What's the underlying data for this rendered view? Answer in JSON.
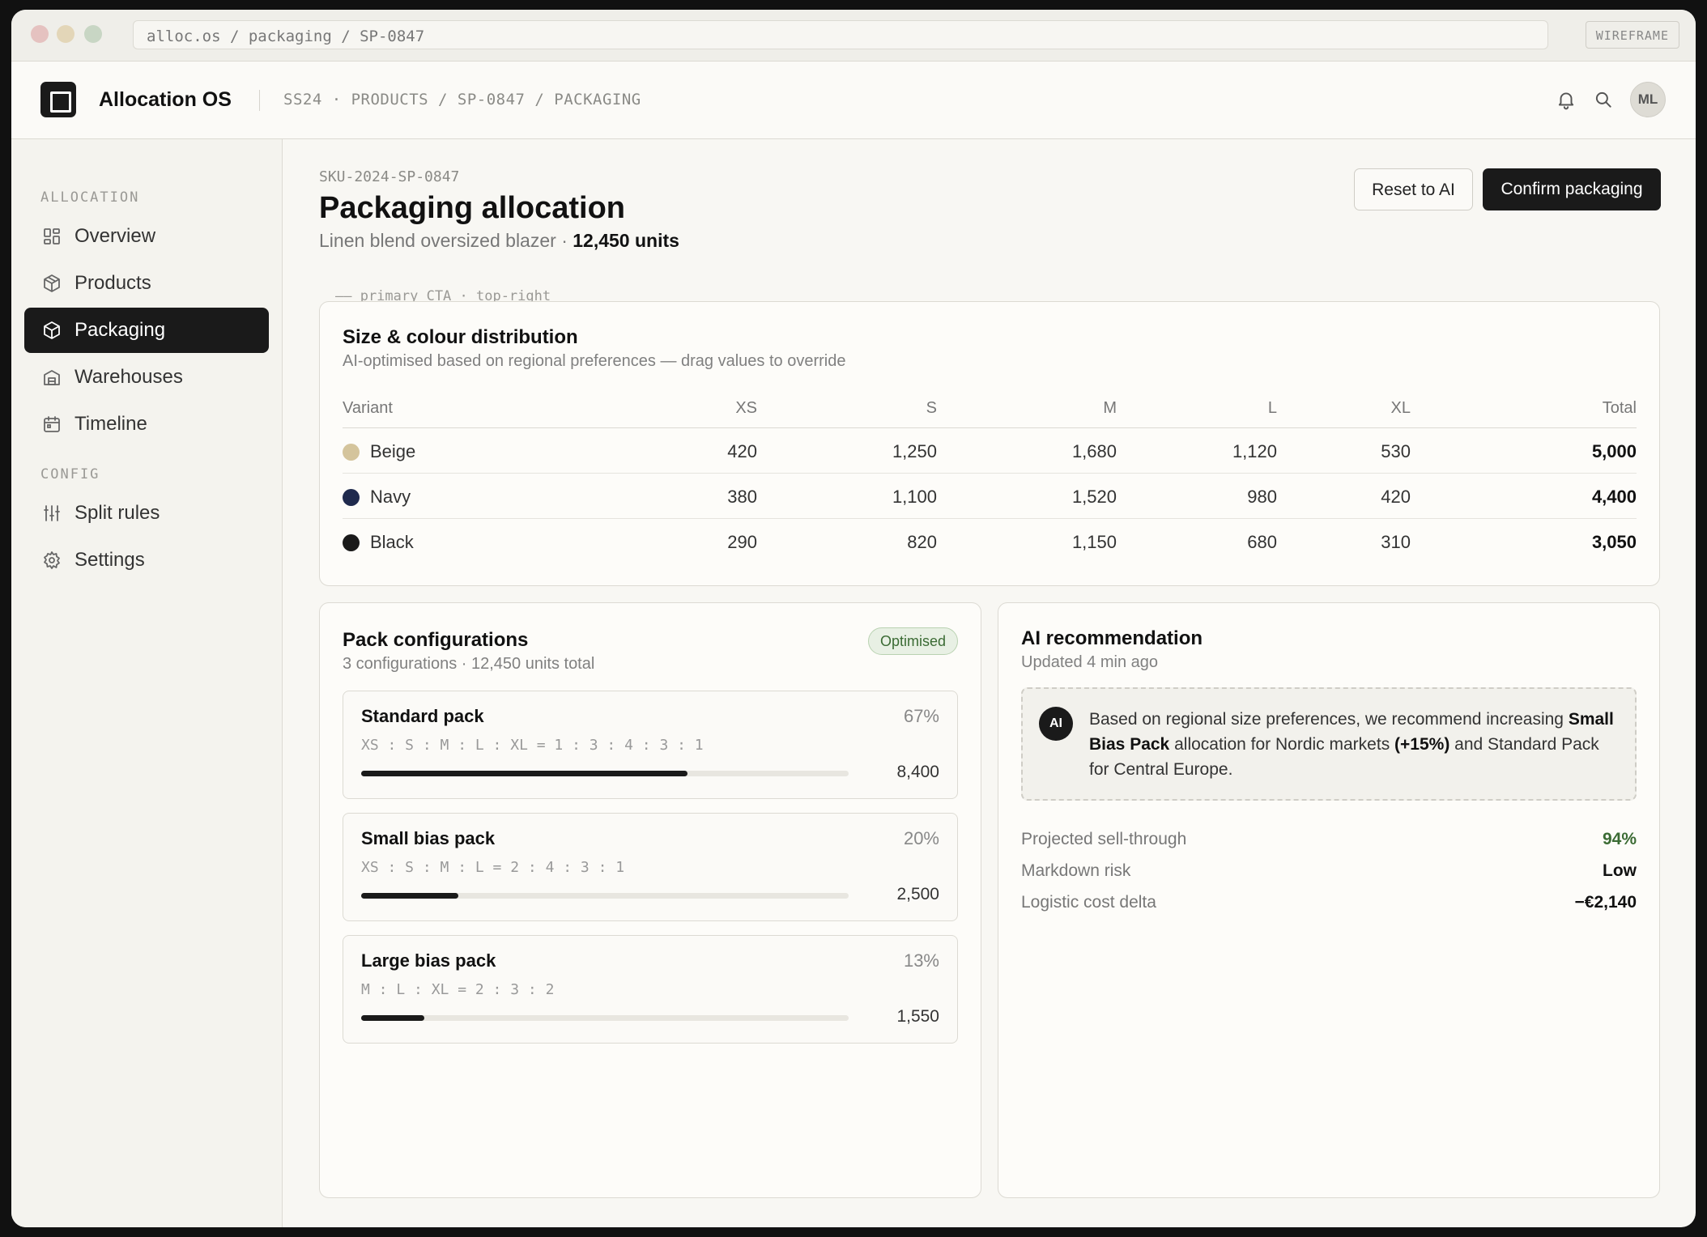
{
  "window": {
    "url": "alloc.os / packaging / SP-0847",
    "badge": "WIREFRAME"
  },
  "header": {
    "app_name": "Allocation OS",
    "breadcrumb": "SS24 · PRODUCTS / SP-0847 / PACKAGING",
    "avatar_initials": "ML"
  },
  "sidebar": {
    "sections": [
      "ALLOCATION",
      "CONFIG"
    ],
    "items": [
      {
        "label": "Overview",
        "icon": "grid-icon",
        "active": false
      },
      {
        "label": "Products",
        "icon": "box-icon",
        "active": false
      },
      {
        "label": "Packaging",
        "icon": "package-icon",
        "active": true
      },
      {
        "label": "Warehouses",
        "icon": "warehouse-icon",
        "active": false
      },
      {
        "label": "Timeline",
        "icon": "calendar-icon",
        "active": false
      },
      {
        "label": "Split rules",
        "icon": "sliders-icon",
        "active": false
      },
      {
        "label": "Settings",
        "icon": "gear-icon",
        "active": false
      }
    ]
  },
  "page": {
    "sku": "SKU-2024-SP-0847",
    "title": "Packaging allocation",
    "product": "Linen blend oversized blazer ·",
    "units": "12,450 units",
    "reset_label": "Reset to AI",
    "confirm_label": "Confirm packaging",
    "annotation": "—— primary CTA · top-right"
  },
  "distribution": {
    "title": "Size & colour distribution",
    "subtitle": "AI-optimised based on regional preferences — drag values to override",
    "columns": [
      "Variant",
      "XS",
      "S",
      "M",
      "L",
      "XL",
      "Total"
    ],
    "rows": [
      {
        "variant": "Beige",
        "color": "#d4c49c",
        "xs": "420",
        "s": "1,250",
        "m": "1,680",
        "l": "1,120",
        "xl": "530",
        "total": "5,000"
      },
      {
        "variant": "Navy",
        "color": "#1f2a4d",
        "xs": "380",
        "s": "1,100",
        "m": "1,520",
        "l": "980",
        "xl": "420",
        "total": "4,400"
      },
      {
        "variant": "Black",
        "color": "#1a1a1a",
        "xs": "290",
        "s": "820",
        "m": "1,150",
        "l": "680",
        "xl": "310",
        "total": "3,050"
      }
    ]
  },
  "packs": {
    "title": "Pack configurations",
    "subtitle": "3 configurations · 12,450 units total",
    "badge": "Optimised",
    "items": [
      {
        "name": "Standard pack",
        "pct": "67%",
        "ratio": "XS : S : M : L : XL = 1 : 3 : 4 : 3 : 1",
        "units": "8,400",
        "fill": 0.67
      },
      {
        "name": "Small bias pack",
        "pct": "20%",
        "ratio": "XS : S : M : L = 2 : 4 : 3 : 1",
        "units": "2,500",
        "fill": 0.2
      },
      {
        "name": "Large bias pack",
        "pct": "13%",
        "ratio": "M : L : XL = 2 : 3 : 2",
        "units": "1,550",
        "fill": 0.13
      }
    ]
  },
  "ai": {
    "title": "AI recommendation",
    "updated": "Updated 4 min ago",
    "icon_text": "AI",
    "text_1": "Based on regional size preferences, we recommend increasing",
    "bold_1": "Small Bias Pack",
    "text_2": "allocation for Nordic markets",
    "bold_2": "(+15%)",
    "text_3": "and Standard Pack for Central Europe.",
    "metrics": [
      {
        "label": "Projected sell-through",
        "value": "94%",
        "color": "#3b6b34"
      },
      {
        "label": "Markdown risk",
        "value": "Low",
        "color": "#111111"
      },
      {
        "label": "Logistic cost delta",
        "value": "−€2,140",
        "color": "#111111"
      }
    ]
  }
}
